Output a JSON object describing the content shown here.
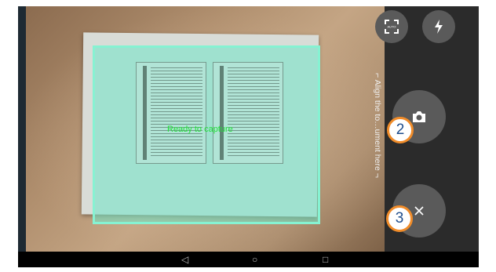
{
  "viewfinder": {
    "status_text": "Ready to capture"
  },
  "controls": {
    "align_hint": "⌐ Align the to…ument here ¬",
    "edge_icon_label": "AUTO",
    "edge_icon": "auto-edge-icon",
    "flash_icon": "flash-icon",
    "capture_icon": "camera-icon",
    "close_icon": "close-icon"
  },
  "nav_bar": {
    "back_icon": "◁",
    "home_icon": "○",
    "recent_icon": "□"
  },
  "callouts": {
    "capture": "2",
    "close": "3"
  },
  "colors": {
    "detect_fill": "#70e6c8",
    "status_text": "#22e03a",
    "callout_border": "#f08c2a",
    "callout_text": "#1f4d8c"
  }
}
